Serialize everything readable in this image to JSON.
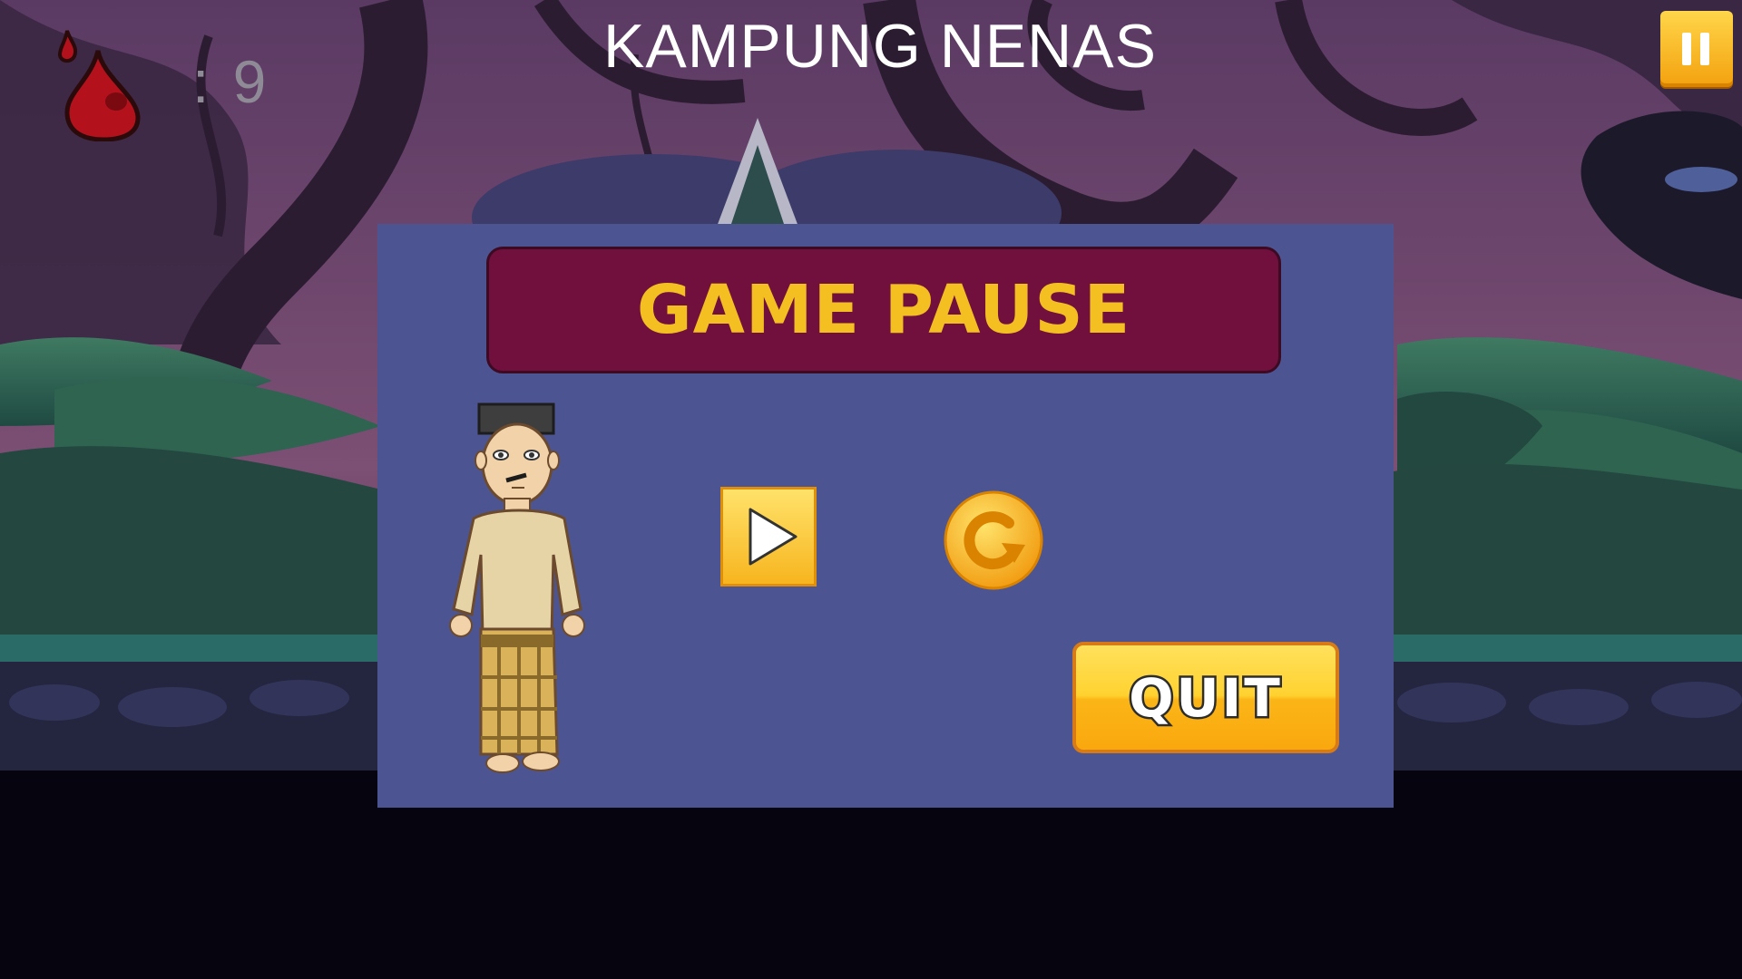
{
  "hud": {
    "title": "KAMPUNG NENAS",
    "score_text": ": 9",
    "blood_icon": "blood-drop-icon",
    "pause_icon": "pause-icon"
  },
  "pause_menu": {
    "title": "GAME PAUSE",
    "character": "malay-villager-character",
    "resume_icon": "play-icon",
    "restart_icon": "restart-icon",
    "quit_label": "QUIT"
  },
  "colors": {
    "panel": "#4c5592",
    "header": "#71103d",
    "title_text": "#f4c021",
    "button_gold": "#f9b418",
    "ground": "#05040f"
  }
}
